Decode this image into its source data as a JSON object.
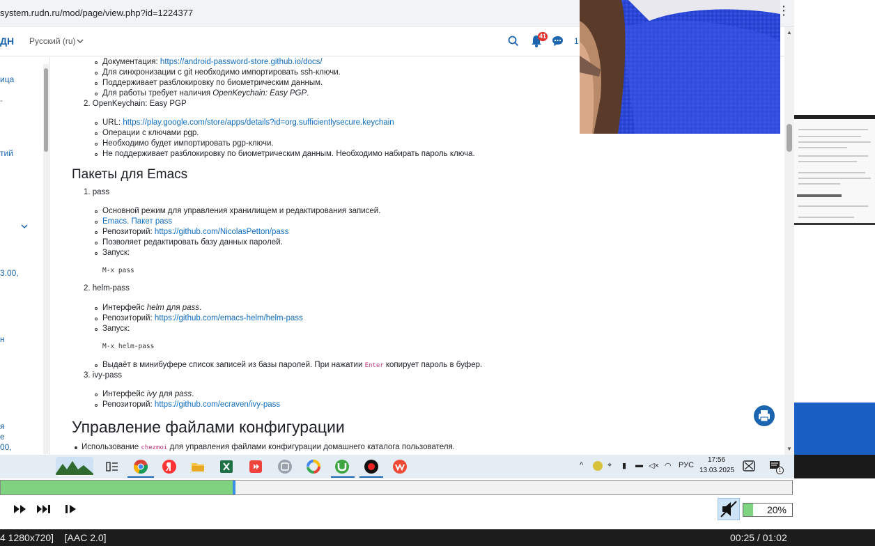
{
  "browser": {
    "url": "system.rudn.ru/mod/page/view.php?id=1224377",
    "menu_glyph": "⋮"
  },
  "navbar": {
    "brand": "ДН",
    "language": "Русский (ru)",
    "notifications_count": "41",
    "messages_count": "1"
  },
  "drawer": {
    "fragments": [
      "ица",
      "-",
      "тий",
      "3.00,",
      "н",
      "я",
      "е",
      "00,"
    ]
  },
  "content": {
    "section1": {
      "items_top": [
        {
          "prefix": "Документация: ",
          "link": "https://android-password-store.github.io/docs/"
        },
        {
          "text": "Для синхронизации с git необходимо импортировать ssh-ключи."
        },
        {
          "text": "Поддерживает разблокировку по биометрическим данным."
        },
        {
          "prefix": "Для работы требует наличия ",
          "em": "OpenKeychain: Easy PGP",
          "suffix": "."
        }
      ],
      "item2_title": "2. OpenKeychain: Easy PGP",
      "item2_list": [
        {
          "prefix": "URL: ",
          "link": "https://play.google.com/store/apps/details?id=org.sufficientlysecure.keychain"
        },
        {
          "text": "Операции с ключами pgp."
        },
        {
          "text": "Необходимо будет импортировать pgp-ключи."
        },
        {
          "text": "Не поддерживает разблокировку по биометрическим данным. Необходимо набирать пароль ключа."
        }
      ]
    },
    "emacs_heading": "Пакеты для Emacs",
    "pass": {
      "title": "1. pass",
      "items": [
        {
          "text": "Основной режим для управления хранилищем и редактирования записей."
        },
        {
          "link": "Emacs. Пакет pass"
        },
        {
          "prefix": "Репозиторий: ",
          "link": "https://github.com/NicolasPetton/pass"
        },
        {
          "text": "Позволяет редактировать базу данных паролей."
        },
        {
          "text": "Запуск:"
        }
      ],
      "code": "M-x pass"
    },
    "helm": {
      "title": "2. helm-pass",
      "item1_prefix": "Интерфейс ",
      "item1_em1": "helm",
      "item1_mid": " для ",
      "item1_em2": "pass",
      "item1_suffix": ".",
      "item2_prefix": "Репозиторий: ",
      "item2_link": "https://github.com/emacs-helm/helm-pass",
      "item3": "Запуск:",
      "code": "M-x helm-pass",
      "item4_prefix": "Выдаёт в минибуфере список записей из базы паролей. При нажатии ",
      "item4_code": "Enter",
      "item4_suffix": " копирует пароль в буфер."
    },
    "ivy": {
      "title": "3. ivy-pass",
      "item1_prefix": "Интерфейс ",
      "item1_em1": "ivy",
      "item1_mid": " для ",
      "item1_em2": "pass",
      "item1_suffix": ".",
      "item2_prefix": "Репозиторий: ",
      "item2_link": "https://github.com/ecraven/ivy-pass"
    },
    "config_heading": "Управление файлами конфигурации",
    "config_item_prefix": "Использование ",
    "config_item_code": "chezmoi",
    "config_item_suffix": " для управления файлами конфигурации домашнего каталога пользователя."
  },
  "taskbar": {
    "lang": "РУС",
    "time": "17:56",
    "date": "13.03.2025",
    "notif_count": "1"
  },
  "player": {
    "progress": 0.295,
    "volume_label": "20%",
    "volume": 0.2,
    "status_left": "4 1280x720]    [AAC 2.0]",
    "status_right": "00:25 / 01:02"
  },
  "colors": {
    "link": "#0f6cbf",
    "accent": "#1b64b0",
    "progress_fill": "#7fd27f",
    "badge": "#e4312d"
  }
}
